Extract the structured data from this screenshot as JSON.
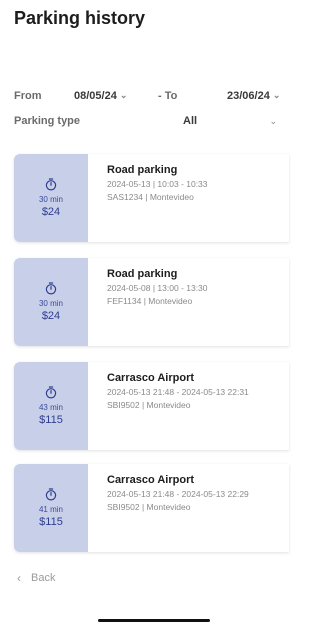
{
  "header": {
    "title": "Parking history"
  },
  "filters": {
    "from_label": "From",
    "from_value": "08/05/24",
    "to_label": "- To",
    "to_value": "23/06/24",
    "type_label": "Parking type",
    "type_value": "All"
  },
  "cards": [
    {
      "duration": "30 min",
      "price": "$24",
      "title": "Road parking",
      "time": "2024-05-13 | 10:03 - 10:33",
      "plate": "SAS1234 | Montevideo"
    },
    {
      "duration": "30 min",
      "price": "$24",
      "title": "Road parking",
      "time": "2024-05-08 | 13:00 - 13:30",
      "plate": "FEF1134 | Montevideo"
    },
    {
      "duration": "43 min",
      "price": "$115",
      "title": "Carrasco Airport",
      "time": "2024-05-13 21:48 - 2024-05-13 22:31",
      "plate": "SBI9502 | Montevideo"
    },
    {
      "duration": "41 min",
      "price": "$115",
      "title": "Carrasco Airport",
      "time": "2024-05-13 21:48 - 2024-05-13 22:29",
      "plate": "SBI9502 | Montevideo"
    }
  ],
  "footer": {
    "back_label": "Back"
  },
  "icons": {
    "card": "timer-icon",
    "back": "chevron-left-icon",
    "dropdown": "chevron-down-icon"
  },
  "colors": {
    "card_accent": "#c8cfe8",
    "card_text": "#2f3d8f"
  }
}
